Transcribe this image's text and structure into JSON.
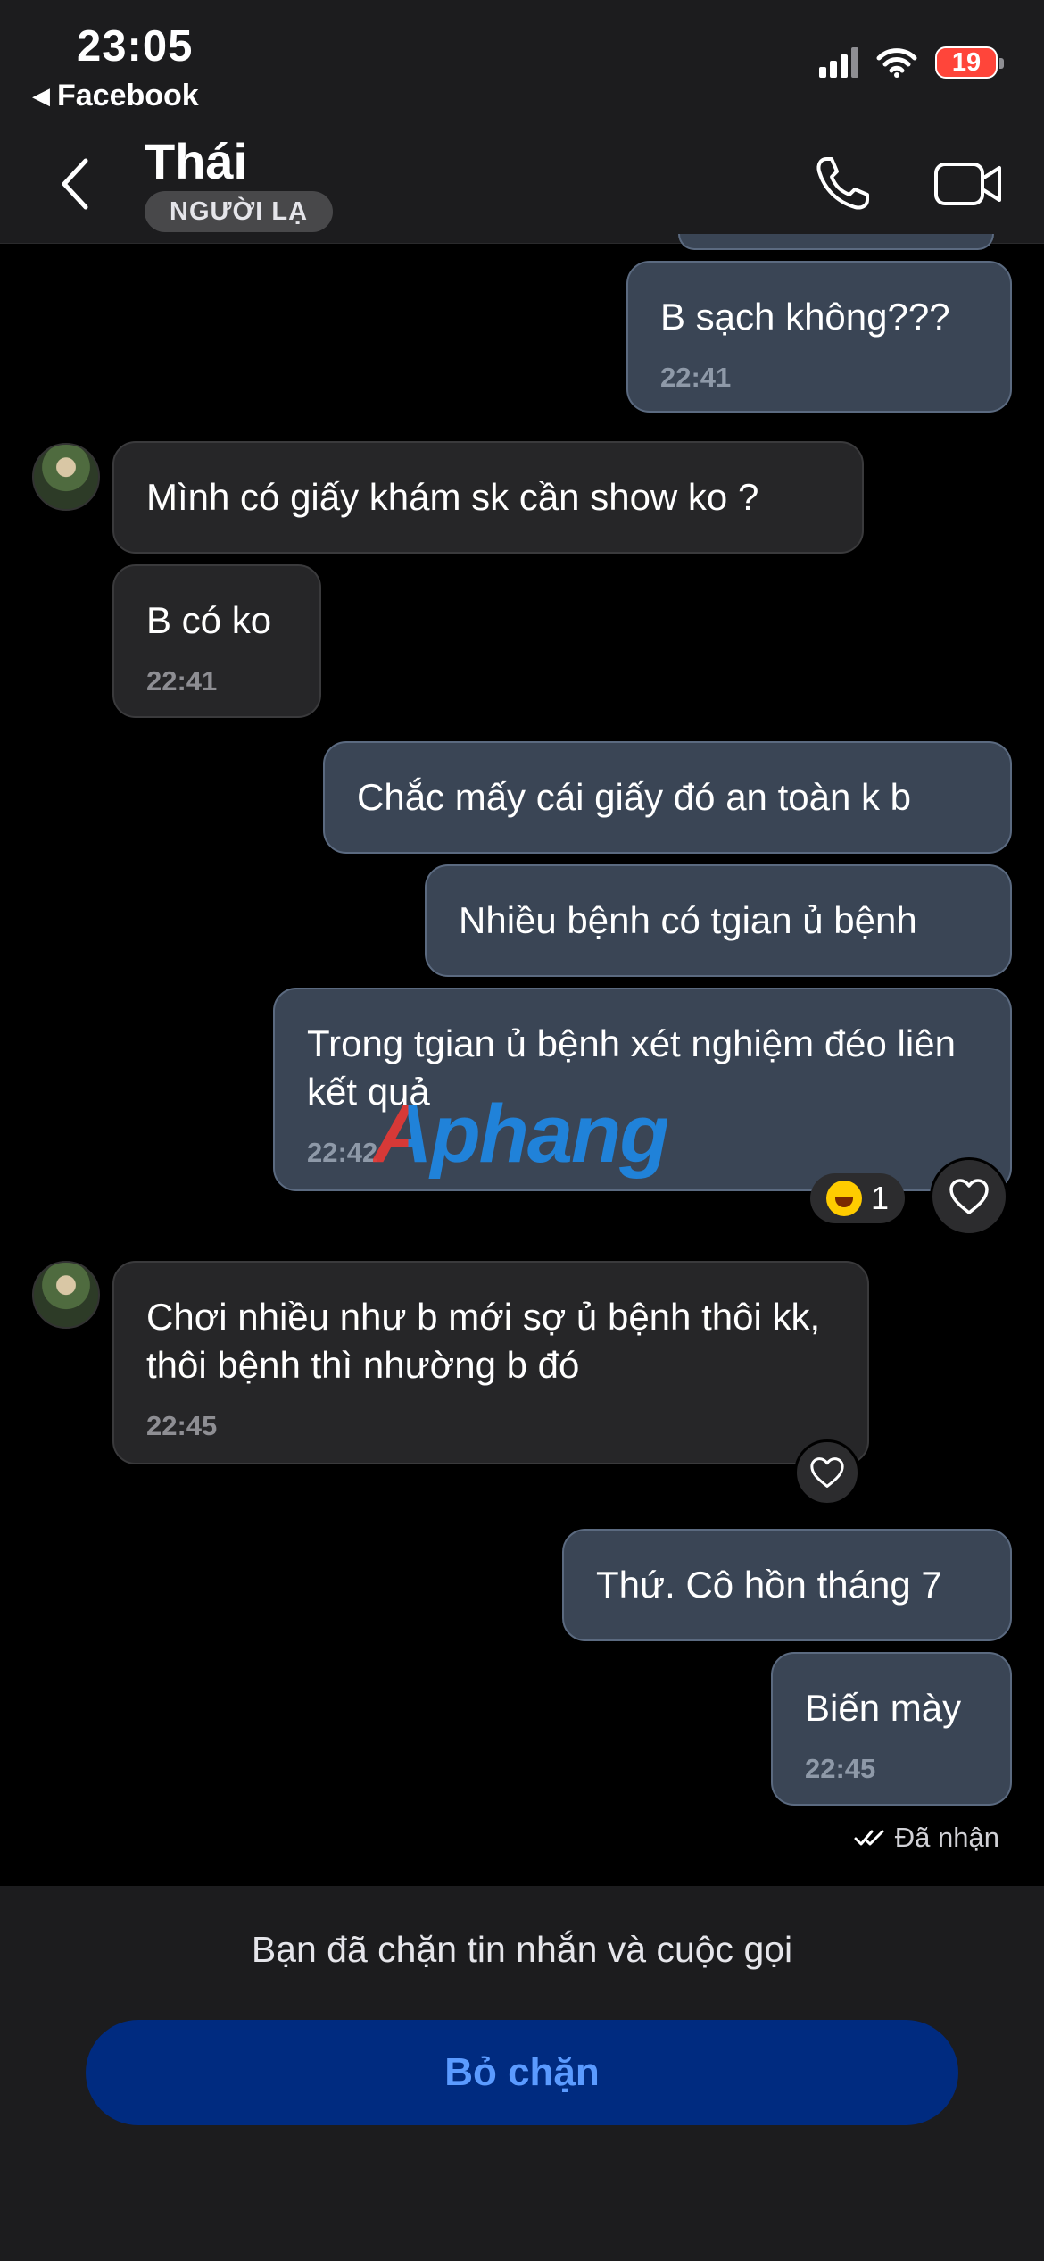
{
  "status_bar": {
    "time": "23:05",
    "back_app": "Facebook",
    "battery": "19"
  },
  "header": {
    "contact_name": "Thái",
    "badge": "NGƯỜI LẠ"
  },
  "messages": [
    {
      "text": "B sạch không???",
      "time": "22:41",
      "direction": "outgoing"
    },
    {
      "text": "Mình có giấy khám sk cần show ko ?",
      "time": "",
      "direction": "incoming"
    },
    {
      "text": "B có ko",
      "time": "22:41",
      "direction": "incoming"
    },
    {
      "text": "Chắc mấy cái giấy đó an toàn k b",
      "time": "",
      "direction": "outgoing"
    },
    {
      "text": "Nhiều bệnh có tgian ủ bệnh",
      "time": "",
      "direction": "outgoing"
    },
    {
      "text": "Trong tgian ủ bệnh xét nghiệm đéo liên kết quả",
      "time": "22:42",
      "direction": "outgoing",
      "reaction_count": "1"
    },
    {
      "text": "Chơi nhiều như b mới sợ ủ bệnh thôi kk, thôi bệnh thì nhường b đó",
      "time": "22:45",
      "direction": "incoming"
    },
    {
      "text": "Thứ. Cô hồn tháng 7",
      "time": "",
      "direction": "outgoing"
    },
    {
      "text": "Biến mày",
      "time": "22:45",
      "direction": "outgoing"
    }
  ],
  "delivery_status": "Đã nhận",
  "watermark": "Aphang",
  "bottom": {
    "blocked_notice": "Bạn đã chặn tin nhắn và cuộc gọi",
    "unblock_label": "Bỏ chặn"
  },
  "colors": {
    "outgoing_bubble": "#3a4555",
    "incoming_bubble": "#262628",
    "unblock_button": "#002b80",
    "unblock_text": "#5b9bff"
  },
  "icons": [
    "cellular-signal-icon",
    "wifi-icon",
    "back-chevron-icon",
    "phone-icon",
    "video-camera-icon",
    "heart-icon",
    "double-check-icon",
    "laughing-emoji-icon"
  ]
}
